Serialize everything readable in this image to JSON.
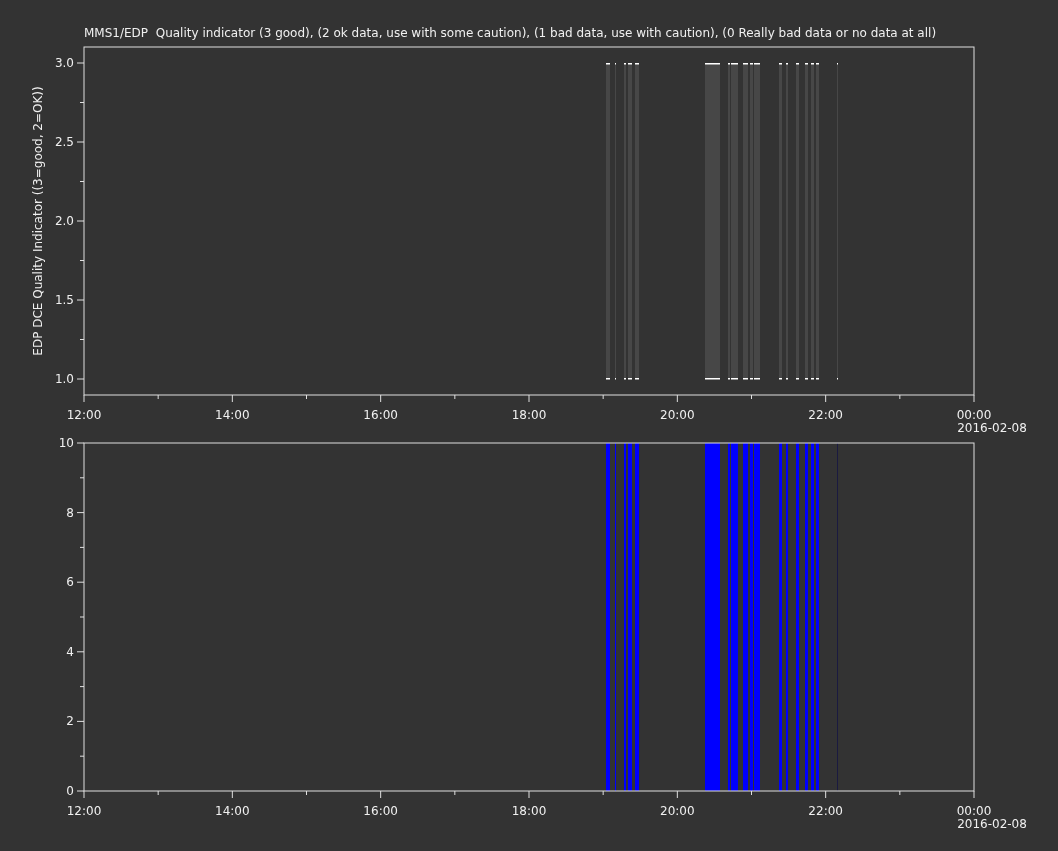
{
  "title": "MMS1/EDP  Quality indicator (3 good), (2 ok data, use with some caution), (1 bad data, use with caution), (0 Really bad data or no data at all)",
  "panels": [
    {
      "kind": "quality",
      "ylabel": "EDP DCE Quality Indicator ((3=good, 2=OK))",
      "yticks": [
        "3.0",
        "2.5",
        "2.0",
        "1.5",
        "1.0"
      ],
      "xticks": [
        "12:00",
        "14:00",
        "16:00",
        "18:00",
        "20:00",
        "22:00",
        "00:00"
      ],
      "date": "2016-02-08"
    },
    {
      "kind": "count",
      "yticks": [
        "10",
        "8",
        "6",
        "4",
        "2",
        "0"
      ],
      "xticks": [
        "12:00",
        "14:00",
        "16:00",
        "18:00",
        "20:00",
        "22:00",
        "00:00"
      ],
      "date": "2016-02-08"
    }
  ]
}
